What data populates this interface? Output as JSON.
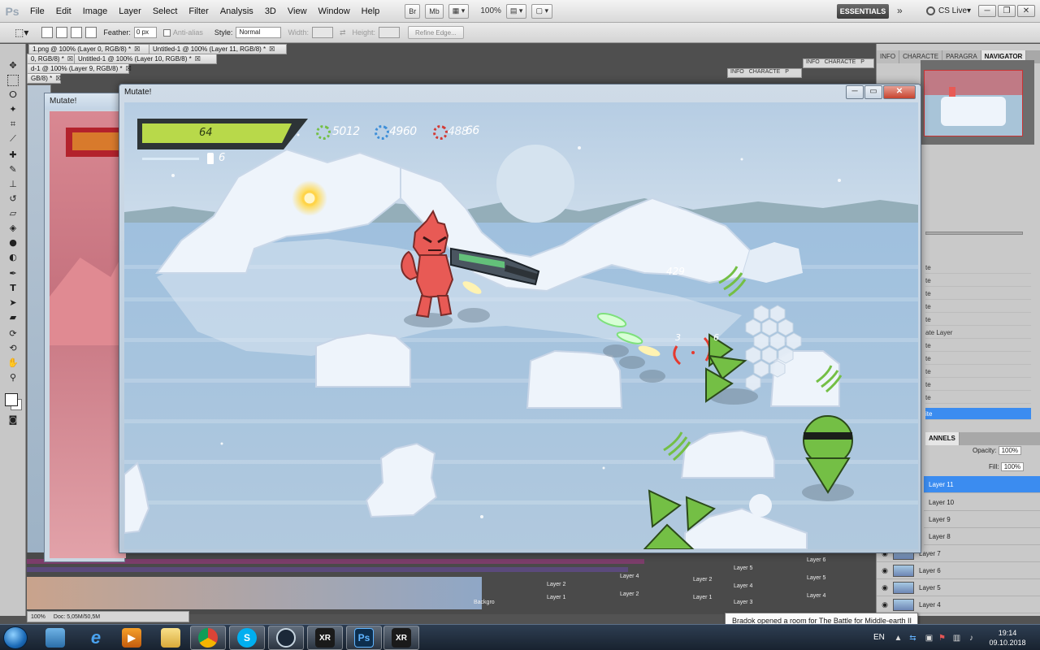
{
  "photoshop": {
    "logo": "Ps",
    "menu": [
      "File",
      "Edit",
      "Image",
      "Layer",
      "Select",
      "Filter",
      "Analysis",
      "3D",
      "View",
      "Window",
      "Help"
    ],
    "menubar_buttons": [
      "Br",
      "Mb"
    ],
    "zoom": "100%",
    "workspace": "ESSENTIALS",
    "workspace_more": "»",
    "cs_live": "CS Live▾",
    "window_controls": [
      "─",
      "❐",
      "✕"
    ],
    "options": {
      "feather_label": "Feather:",
      "feather_value": "0 px",
      "antialias_label": "Anti-alias",
      "style_label": "Style:",
      "style_value": "Normal",
      "width_label": "Width:",
      "height_label": "Height:",
      "refine_edge": "Refine Edge..."
    },
    "doc_tabs": [
      "1.png @ 100% (Layer 0, RGB/8) *",
      "0, RGB/8) *",
      "Untitled-1 @ 100% (Layer 11, RGB/8) *",
      "Untitled-1 @ 100% (Layer 10, RGB/8) *",
      "d-1 @ 100% (Layer 9, RGB/8) *",
      "GB/8) *"
    ],
    "mini_panel_tabs": [
      "INFO",
      "CHARACTE",
      "P"
    ],
    "status": {
      "zoom": "100%",
      "doc": "Doc: 5,05M/50,5M"
    }
  },
  "panels": {
    "top_tabs": [
      "INFO",
      "CHARACTE",
      "PARAGRA",
      "NAVIGATOR"
    ],
    "history_items": [
      "te",
      "te",
      "te",
      "te",
      "te",
      "ate Layer",
      "te",
      "te",
      "te",
      "te",
      "te",
      "ite"
    ],
    "layers_tab": "ANNELS",
    "opacity_label": "Opacity:",
    "opacity_value": "100%",
    "fill_label": "Fill:",
    "fill_value": "100%",
    "layers": [
      "Layer 11",
      "Layer 10",
      "Layer 9",
      "Layer 8",
      "Layer 7",
      "Layer 6",
      "Layer 5",
      "Layer 4"
    ],
    "selected_layer": "Layer 11"
  },
  "background_layers": [
    "Layer 6",
    "Layer 5",
    "Layer 4",
    "Layer 5",
    "Layer 4",
    "Layer 3",
    "Layer 2",
    "Layer 1",
    "Layer 4",
    "Layer 2",
    "Layer 2",
    "Layer 1",
    "Backgro"
  ],
  "game_window": {
    "title": "Mutate!",
    "back_title": "Mutate!",
    "controls": [
      "─",
      "▭",
      "✕"
    ],
    "hud": {
      "health": "64",
      "ammo": "6",
      "score_green": "5012",
      "score_blue": "4960",
      "score_red": "488",
      "score_red_overlap": "66",
      "damage_number": "429",
      "combo_left": "3",
      "combo_right": "6"
    },
    "colors": {
      "health_bar": "#b8d94a",
      "sky": "#b9d1e6",
      "ice": "#eef4fb",
      "player": "#e85a55",
      "enemy": "#74bf45"
    }
  },
  "taskbar": {
    "apps": [
      {
        "name": "start",
        "label": ""
      },
      {
        "name": "app-blue",
        "label": ""
      },
      {
        "name": "ie",
        "label": "e"
      },
      {
        "name": "media",
        "label": "▶"
      },
      {
        "name": "explorer",
        "label": ""
      },
      {
        "name": "chrome",
        "label": ""
      },
      {
        "name": "skype",
        "label": "S"
      },
      {
        "name": "steam",
        "label": ""
      },
      {
        "name": "xr-app",
        "label": "XR"
      },
      {
        "name": "photoshop",
        "label": "Ps"
      },
      {
        "name": "xr-app-2",
        "label": "XR"
      }
    ],
    "language": "EN",
    "time": "19:14",
    "date": "09.10.2018",
    "notification": "Bradok opened a room for The Battle for Middle-earth II"
  }
}
